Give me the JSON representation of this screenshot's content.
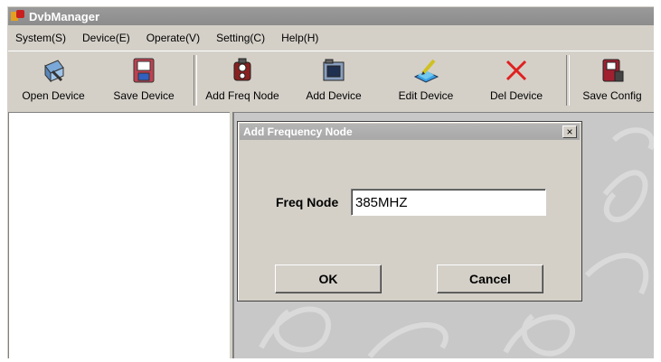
{
  "window": {
    "title": "DvbManager"
  },
  "menu": [
    "System(S)",
    "Device(E)",
    "Operate(V)",
    "Setting(C)",
    "Help(H)"
  ],
  "toolbar": {
    "open_device": "Open Device",
    "save_device": "Save Device",
    "add_freq_node": "Add Freq Node",
    "add_device": "Add Device",
    "edit_device": "Edit Device",
    "del_device": "Del Device",
    "save_config": "Save Config"
  },
  "dialog": {
    "title": "Add Frequency Node",
    "close_glyph": "×",
    "freq_label": "Freq Node",
    "freq_value": "385MHZ",
    "ok_label": "OK",
    "cancel_label": "Cancel"
  },
  "colors": {
    "titlebar": "#9a9a9a",
    "face": "#d4d0c8",
    "del_red": "#e02020"
  }
}
